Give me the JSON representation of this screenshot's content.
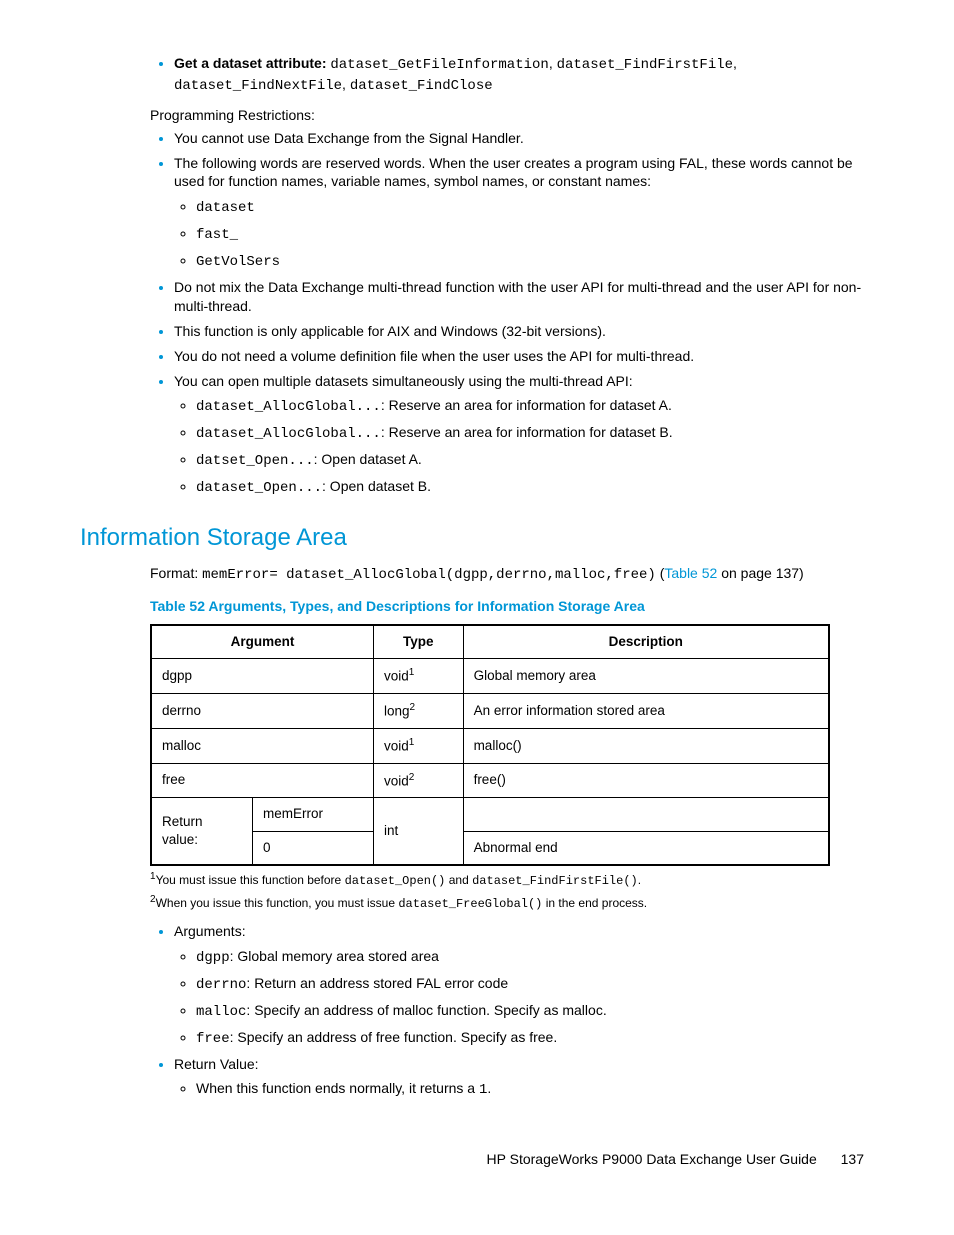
{
  "bullets_top": {
    "b0_text": "Get a dataset attribute: ",
    "b0_c0": "dataset_GetFileInformation",
    "b0_c1": "dataset_FindFirstFile",
    "b0_c2": "dataset_FindNextFile",
    "b0_c3": "dataset_FindClose"
  },
  "restrict_label": "Programming Restrictions:",
  "restrict": {
    "r0": "You cannot use Data Exchange from the Signal Handler.",
    "r1": "The following words are reserved words. When the user creates a program using FAL, these words cannot be used for function names, variable names, symbol names, or constant names:",
    "r1a": "dataset",
    "r1b": "fast_",
    "r1c": "GetVolSers",
    "r2": "Do not mix the Data Exchange multi-thread function with the user API for multi-thread and the user API for non-multi-thread.",
    "r3": "This function is only applicable for AIX and Windows (32-bit versions).",
    "r4": "You do not need a volume definition file when the user uses the API for multi-thread.",
    "r5": "You can open multiple datasets simultaneously using the multi-thread API:",
    "r5a_code": "dataset_AllocGlobal...",
    "r5a_text": ": Reserve an area for information for dataset A.",
    "r5b_code": "dataset_AllocGlobal...",
    "r5b_text": ": Reserve an area for information for dataset B.",
    "r5c_code": "datset_Open...",
    "r5c_text": ": Open dataset A.",
    "r5d_code": "dataset_Open...",
    "r5d_text": ": Open dataset B."
  },
  "section_title": "Information Storage Area",
  "format": {
    "label": "Format: ",
    "code": "memError= dataset_AllocGlobal(dgpp,derrno,malloc,free)",
    "paren_open": " (",
    "link": "Table 52",
    "rest": " on page 137)"
  },
  "table_title": "Table 52 Arguments, Types, and Descriptions for Information Storage Area",
  "th": {
    "a": "Argument",
    "b": "Type",
    "c": "Description"
  },
  "rows": {
    "r0a": "dgpp",
    "r0b": "void",
    "r0bs": "1",
    "r0c": "Global memory area",
    "r1a": "derrno",
    "r1b": "long",
    "r1bs": "2",
    "r1c": "An error information stored area",
    "r2a": "malloc",
    "r2b": "void",
    "r2bs": "1",
    "r2c": "malloc()",
    "r3a": "free",
    "r3b": "void",
    "r3bs": "2",
    "r3c": "free()",
    "r4a": "Return value:",
    "r4a1": "memError",
    "r4a2": "0",
    "r4b": "int",
    "r4c1": "",
    "r4c2": "Abnormal end"
  },
  "fn1": {
    "sup": "1",
    "a": "You must issue this function before ",
    "c1": "dataset_Open()",
    "mid": " and ",
    "c2": "dataset_FindFirstFile()",
    "end": "."
  },
  "fn2": {
    "sup": "2",
    "a": "When you issue this function, you must issue ",
    "c1": "dataset_FreeGlobal()",
    "end": " in the end process."
  },
  "args_label": "Arguments:",
  "args": {
    "a0c": "dgpp",
    "a0t": ": Global memory area stored area",
    "a1c": "derrno",
    "a1t": ": Return an address stored FAL error code",
    "a2c": "malloc",
    "a2t": ": Specify an address of malloc function. Specify as malloc.",
    "a3c": "free",
    "a3t": ": Specify an address of free function. Specify as free."
  },
  "ret_label": "Return Value:",
  "ret": {
    "pre": "When this function ends normally, it returns a ",
    "code": "1",
    "post": "."
  },
  "footer": {
    "title": "HP StorageWorks P9000 Data Exchange User Guide",
    "page": "137"
  }
}
